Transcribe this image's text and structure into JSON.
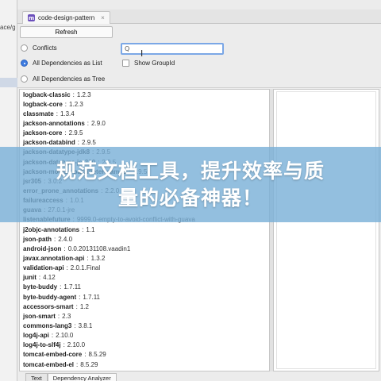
{
  "left_strip": {
    "path_text": "ace/g"
  },
  "tab": {
    "icon": "m",
    "title": "code-design-pattern",
    "close": "×"
  },
  "toolbar": {
    "refresh_label": "Refresh",
    "conflicts_label": "Conflicts",
    "all_deps_list_label": "All Dependencies as List",
    "all_deps_tree_label": "All Dependencies as Tree",
    "show_groupid_label": "Show GroupId",
    "search_value": "",
    "search_icon": "Q",
    "view_mode": "list"
  },
  "dependencies": [
    {
      "name": "logback-classic",
      "version": "1.2.3"
    },
    {
      "name": "logback-core",
      "version": "1.2.3"
    },
    {
      "name": "classmate",
      "version": "1.3.4"
    },
    {
      "name": "jackson-annotations",
      "version": "2.9.0"
    },
    {
      "name": "jackson-core",
      "version": "2.9.5"
    },
    {
      "name": "jackson-databind",
      "version": "2.9.5"
    },
    {
      "name": "jackson-datatype-jdk8",
      "version": "2.9.5"
    },
    {
      "name": "jackson-datatype-jsr310",
      "version": "2.9.5"
    },
    {
      "name": "jackson-module-parameter-names",
      "version": "2.9.5"
    },
    {
      "name": "jsr305",
      "version": "3.0.2"
    },
    {
      "name": "error_prone_annotations",
      "version": "2.2.0"
    },
    {
      "name": "failureaccess",
      "version": "1.0.1"
    },
    {
      "name": "guava",
      "version": "27.0.1-jre"
    },
    {
      "name": "listenablefuture",
      "version": "9999.0-empty-to-avoid-conflict-with-guava"
    },
    {
      "name": "j2objc-annotations",
      "version": "1.1"
    },
    {
      "name": "json-path",
      "version": "2.4.0"
    },
    {
      "name": "android-json",
      "version": "0.0.20131108.vaadin1"
    },
    {
      "name": "javax.annotation-api",
      "version": "1.3.2"
    },
    {
      "name": "validation-api",
      "version": "2.0.1.Final"
    },
    {
      "name": "junit",
      "version": "4.12"
    },
    {
      "name": "byte-buddy",
      "version": "1.7.11"
    },
    {
      "name": "byte-buddy-agent",
      "version": "1.7.11"
    },
    {
      "name": "accessors-smart",
      "version": "1.2"
    },
    {
      "name": "json-smart",
      "version": "2.3"
    },
    {
      "name": "commons-lang3",
      "version": "3.8.1"
    },
    {
      "name": "log4j-api",
      "version": "2.10.0"
    },
    {
      "name": "log4j-to-slf4j",
      "version": "2.10.0"
    },
    {
      "name": "tomcat-embed-core",
      "version": "8.5.29"
    },
    {
      "name": "tomcat-embed-el",
      "version": "8.5.29"
    }
  ],
  "bottom_tabs": {
    "text": "Text",
    "analyzer": "Dependency Analyzer"
  },
  "banner": {
    "line1": "规范文档工具，提升效率与质",
    "line2": "量的必备神器！"
  }
}
